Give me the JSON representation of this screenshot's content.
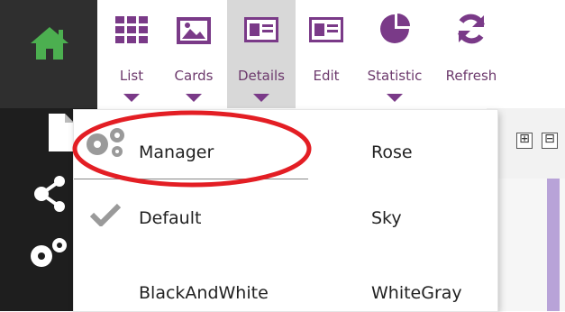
{
  "toolbar": {
    "buttons": [
      {
        "label": "List",
        "icon": "grid-icon",
        "has_caret": true
      },
      {
        "label": "Cards",
        "icon": "image-card-icon",
        "has_caret": true
      },
      {
        "label": "Details",
        "icon": "details-card-icon",
        "has_caret": true,
        "active": true
      },
      {
        "label": "Edit",
        "icon": "edit-card-icon",
        "has_caret": false
      },
      {
        "label": "Statistic",
        "icon": "pie-chart-icon",
        "has_caret": true
      },
      {
        "label": "Refresh",
        "icon": "refresh-icon",
        "has_caret": false
      }
    ]
  },
  "sidebar": {
    "icons": [
      "home-icon",
      "document-icon",
      "share-icon",
      "gears-icon"
    ]
  },
  "theme_menu": {
    "items": [
      {
        "left": "Manager",
        "left_icon": "gears-icon",
        "right": "Rose"
      },
      {
        "left": "Default",
        "left_icon": "checkmark-icon",
        "right": "Sky",
        "selected": true
      },
      {
        "left": "BlackAndWhite",
        "right": "WhiteGray"
      }
    ]
  },
  "content": {
    "expand_symbol": "⊞",
    "collapse_symbol": "⊟"
  },
  "colors": {
    "toolbar_icon": "#7a3a88",
    "home_icon": "#4caf50",
    "sidebar_bg": "#1e1e1e",
    "annotation": "#e31e24",
    "accent_line": "#b8a3d8"
  }
}
